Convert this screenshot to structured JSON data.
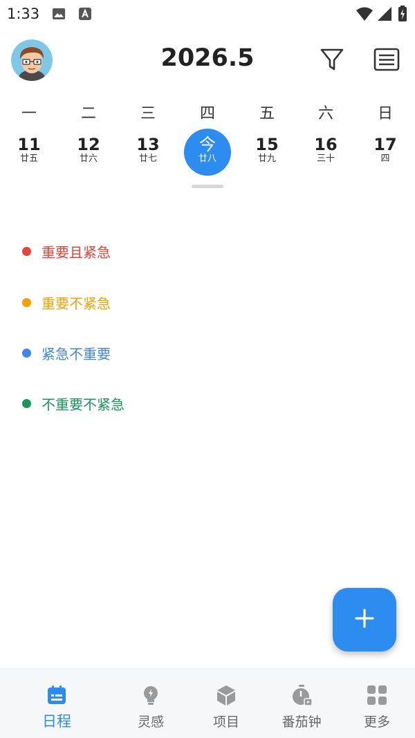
{
  "status_bar": {
    "time": "1:33",
    "icons": [
      "image-icon",
      "text-a-icon",
      "wifi-icon",
      "signal-icon",
      "battery-charging-icon"
    ]
  },
  "header": {
    "title": "2026.5",
    "avatar": "cartoon-avatar",
    "filter_icon": "filter-icon",
    "list_icon": "list-view-icon"
  },
  "calendar": {
    "weekdays": [
      "一",
      "二",
      "三",
      "四",
      "五",
      "六",
      "日"
    ],
    "days": [
      {
        "num": "11",
        "lunar": "廿五"
      },
      {
        "num": "12",
        "lunar": "廿六"
      },
      {
        "num": "13",
        "lunar": "廿七"
      },
      {
        "num": "今",
        "lunar": "廿八",
        "today": true
      },
      {
        "num": "15",
        "lunar": "廿九"
      },
      {
        "num": "16",
        "lunar": "三十"
      },
      {
        "num": "17",
        "lunar": "四"
      }
    ]
  },
  "categories": [
    {
      "label": "重要且紧急",
      "color": "#e0463a"
    },
    {
      "label": "重要不紧急",
      "color": "#f5a100"
    },
    {
      "label": "紧急不重要",
      "color": "#3f86ec"
    },
    {
      "label": "不重要不紧急",
      "color": "#16985a"
    }
  ],
  "fab": {
    "icon": "plus-icon"
  },
  "bottom_nav": {
    "items": [
      {
        "label": "日程",
        "icon": "calendar-icon",
        "active": true
      },
      {
        "label": "灵感",
        "icon": "lightbulb-icon"
      },
      {
        "label": "项目",
        "icon": "cube-icon"
      },
      {
        "label": "番茄钟",
        "icon": "timer-icon"
      },
      {
        "label": "更多",
        "icon": "grid-icon"
      }
    ],
    "active_color": "#2d8cf0",
    "inactive_color": "#9a9a9a"
  }
}
